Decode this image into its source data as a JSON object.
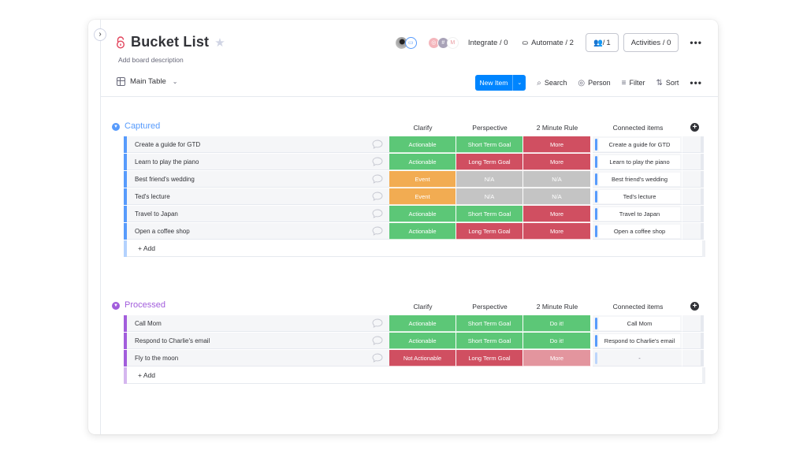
{
  "board": {
    "title": "Bucket List",
    "description": "Add board description",
    "view_label": "Main Table",
    "integrate_label": "Integrate / 0",
    "automate_label": "Automate / 2",
    "members_label": "1",
    "activities_label": "Activities / 0"
  },
  "toolbar": {
    "new_item_label": "New Item",
    "search_label": "Search",
    "person_label": "Person",
    "filter_label": "Filter",
    "sort_label": "Sort"
  },
  "columns": [
    "Clarify",
    "Perspective",
    "2 Minute Rule",
    "Connected items"
  ],
  "colors": {
    "captured": "#579bfc",
    "processed": "#a25ddc",
    "green": "#5cc777",
    "red": "#d04f61",
    "orange": "#f2ac52",
    "grey": "#c4c4c4",
    "pink": "#e3959e"
  },
  "groups": [
    {
      "name": "Captured",
      "add_label": "+ Add",
      "rows": [
        {
          "name": "Create a guide for GTD",
          "clarify": "Actionable",
          "perspective": "Short Term Goal",
          "two_min": "More",
          "connected": "Create a guide for GTD"
        },
        {
          "name": "Learn to play the piano",
          "clarify": "Actionable",
          "perspective": "Long Term Goal",
          "two_min": "More",
          "connected": "Learn to play the piano"
        },
        {
          "name": "Best friend's wedding",
          "clarify": "Event",
          "perspective": "N/A",
          "two_min": "N/A",
          "connected": "Best friend's wedding"
        },
        {
          "name": "Ted's lecture",
          "clarify": "Event",
          "perspective": "N/A",
          "two_min": "N/A",
          "connected": "Ted's lecture"
        },
        {
          "name": "Travel to Japan",
          "clarify": "Actionable",
          "perspective": "Short Term Goal",
          "two_min": "More",
          "connected": "Travel to Japan"
        },
        {
          "name": "Open a coffee shop",
          "clarify": "Actionable",
          "perspective": "Long Term Goal",
          "two_min": "More",
          "connected": "Open a coffee shop"
        }
      ]
    },
    {
      "name": "Processed",
      "add_label": "+ Add",
      "rows": [
        {
          "name": "Call Mom",
          "clarify": "Actionable",
          "perspective": "Short Term Goal",
          "two_min": "Do it!",
          "connected": "Call Mom"
        },
        {
          "name": "Respond to Charlie's email",
          "clarify": "Actionable",
          "perspective": "Short Term Goal",
          "two_min": "Do it!",
          "connected": "Respond to Charlie's email"
        },
        {
          "name": "Fly to the moon",
          "clarify": "Not Actionable",
          "perspective": "Long Term Goal",
          "two_min": "More",
          "connected": "-"
        }
      ]
    }
  ]
}
